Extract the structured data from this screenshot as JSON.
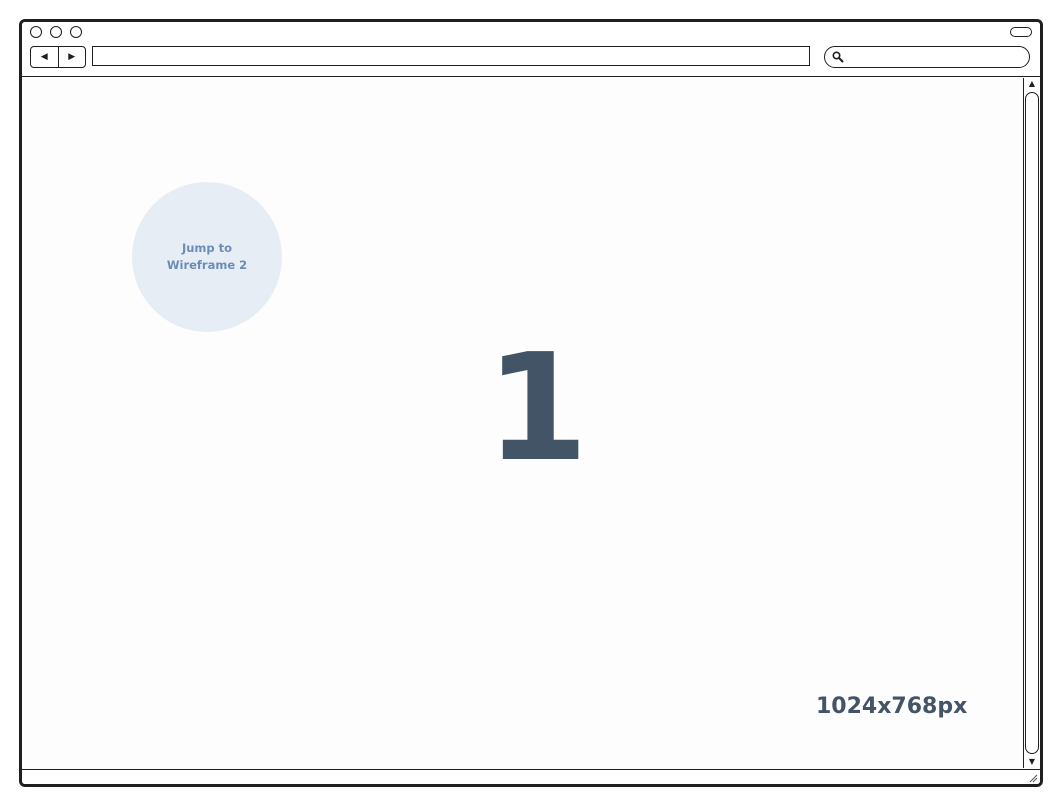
{
  "browser": {
    "address_value": "",
    "search_value": "",
    "nav": {
      "back_glyph": "◀",
      "forward_glyph": "▶"
    },
    "icons": [
      "window-close-icon",
      "window-minimize-icon",
      "window-zoom-icon",
      "pill-control-icon",
      "search-icon",
      "scroll-up-icon",
      "scroll-down-icon",
      "resize-grip-icon"
    ]
  },
  "content": {
    "jump_link": {
      "line1": "Jump to",
      "line2": "Wireframe 2"
    },
    "wireframe_number": "1",
    "size_label": "1024x768px"
  },
  "colors": {
    "frame": "#1f1f1f",
    "circle_bg": "#e7edf4",
    "circle_text": "#6b8db5",
    "number_text": "#435466"
  }
}
